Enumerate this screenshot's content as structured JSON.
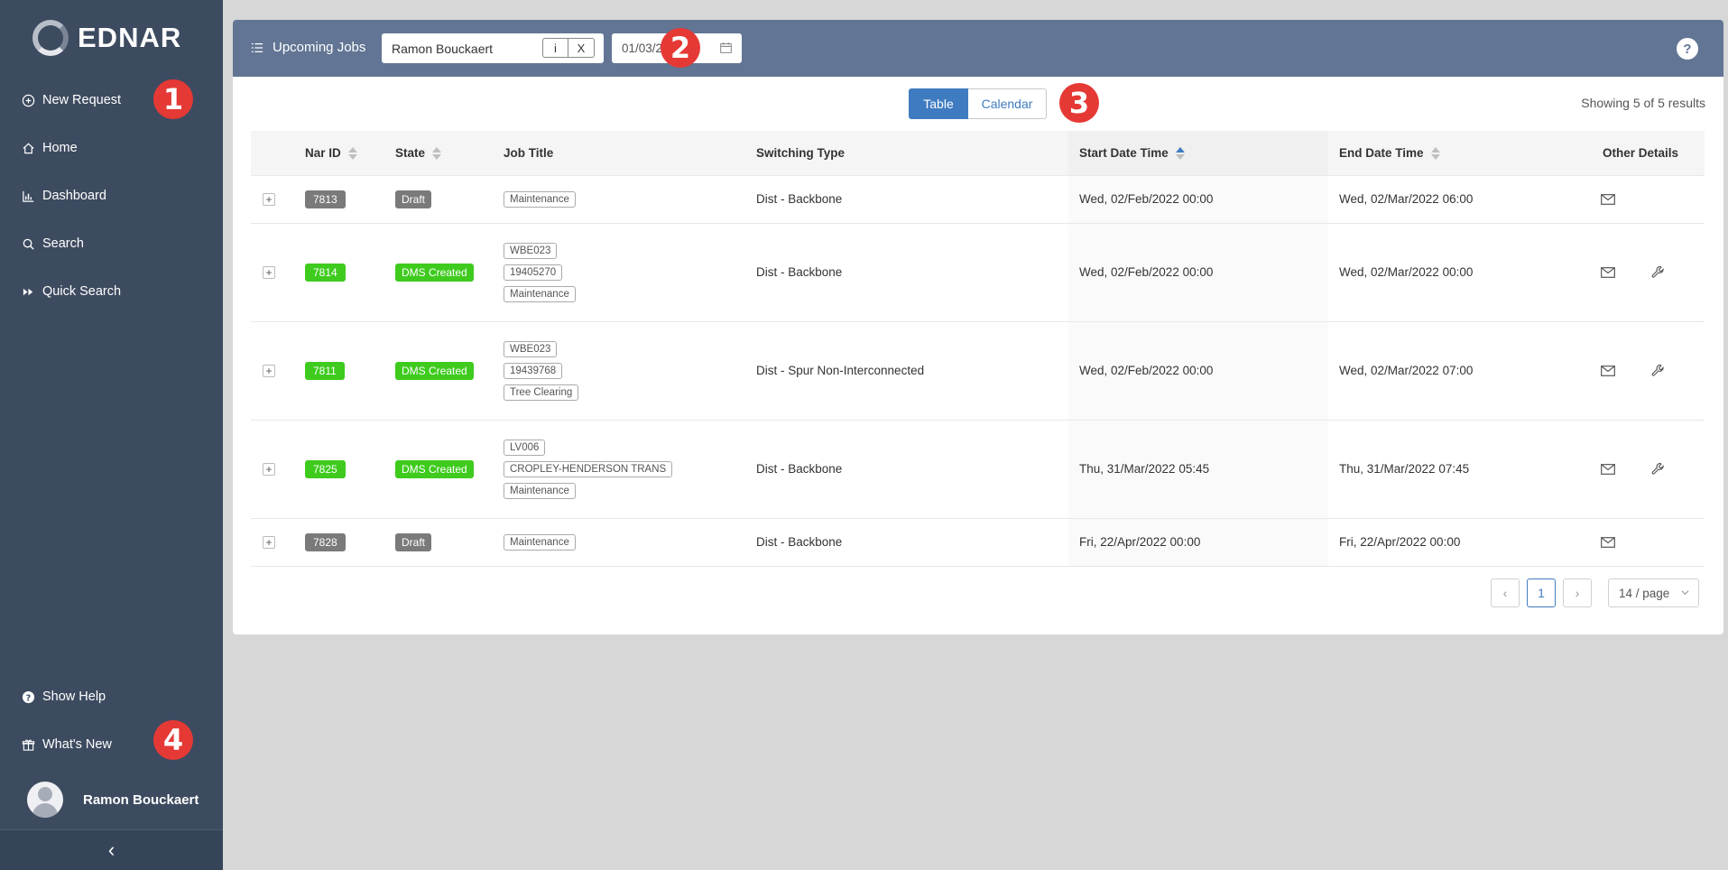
{
  "app": {
    "name": "EDNAR"
  },
  "sidebar": {
    "items": [
      {
        "label": "New Request",
        "icon": "plus-circle-icon"
      },
      {
        "label": "Home",
        "icon": "home-icon"
      },
      {
        "label": "Dashboard",
        "icon": "bar-chart-icon"
      },
      {
        "label": "Search",
        "icon": "search-icon"
      },
      {
        "label": "Quick Search",
        "icon": "fast-forward-icon"
      }
    ],
    "bottom": [
      {
        "label": "Show Help",
        "icon": "question-circle-icon"
      },
      {
        "label": "What's New",
        "icon": "gift-icon"
      }
    ],
    "user": "Ramon Bouckaert",
    "collapse": "‹"
  },
  "markers": [
    "1",
    "2",
    "3",
    "4"
  ],
  "header": {
    "title": "Upcoming Jobs",
    "user_select": "Ramon Bouckaert",
    "info_btn": "i",
    "clear_btn": "X",
    "date": "01/03/2022",
    "help": "?"
  },
  "views": {
    "table": "Table",
    "calendar": "Calendar"
  },
  "showing": "Showing 5 of 5 results",
  "table": {
    "columns": [
      "Nar ID",
      "State",
      "Job Title",
      "Switching Type",
      "Start Date Time",
      "End Date Time",
      "Other Details"
    ],
    "rows": [
      {
        "nar": "7813",
        "state": "Draft",
        "tags": [
          "Maintenance"
        ],
        "switching": "Dist - Backbone",
        "start": "Wed, 02/Feb/2022 00:00",
        "end": "Wed, 02/Mar/2022 06:00",
        "wrench": false
      },
      {
        "nar": "7814",
        "state": "DMS Created",
        "tags": [
          "WBE023",
          "19405270",
          "Maintenance"
        ],
        "switching": "Dist - Backbone",
        "start": "Wed, 02/Feb/2022 00:00",
        "end": "Wed, 02/Mar/2022 00:00",
        "wrench": true
      },
      {
        "nar": "7811",
        "state": "DMS Created",
        "tags": [
          "WBE023",
          "19439768",
          "Tree Clearing"
        ],
        "switching": "Dist - Spur Non-Interconnected",
        "start": "Wed, 02/Feb/2022 00:00",
        "end": "Wed, 02/Mar/2022 07:00",
        "wrench": true
      },
      {
        "nar": "7825",
        "state": "DMS Created",
        "tags": [
          "LV006",
          "CROPLEY-HENDERSON TRANS",
          "Maintenance"
        ],
        "switching": "Dist - Backbone",
        "start": "Thu, 31/Mar/2022 05:45",
        "end": "Thu, 31/Mar/2022 07:45",
        "wrench": true
      },
      {
        "nar": "7828",
        "state": "Draft",
        "tags": [
          "Maintenance"
        ],
        "switching": "Dist - Backbone",
        "start": "Fri, 22/Apr/2022 00:00",
        "end": "Fri, 22/Apr/2022 00:00",
        "wrench": false
      }
    ]
  },
  "pagination": {
    "prev": "‹",
    "current": "1",
    "next": "›",
    "page_size": "14 / page"
  },
  "colors": {
    "sidebar": "#3d4b60",
    "header": "#627594",
    "accent": "#3f7bc1",
    "green": "#3ecb1e",
    "draft": "#7a7a7a",
    "marker": "#e53935"
  }
}
